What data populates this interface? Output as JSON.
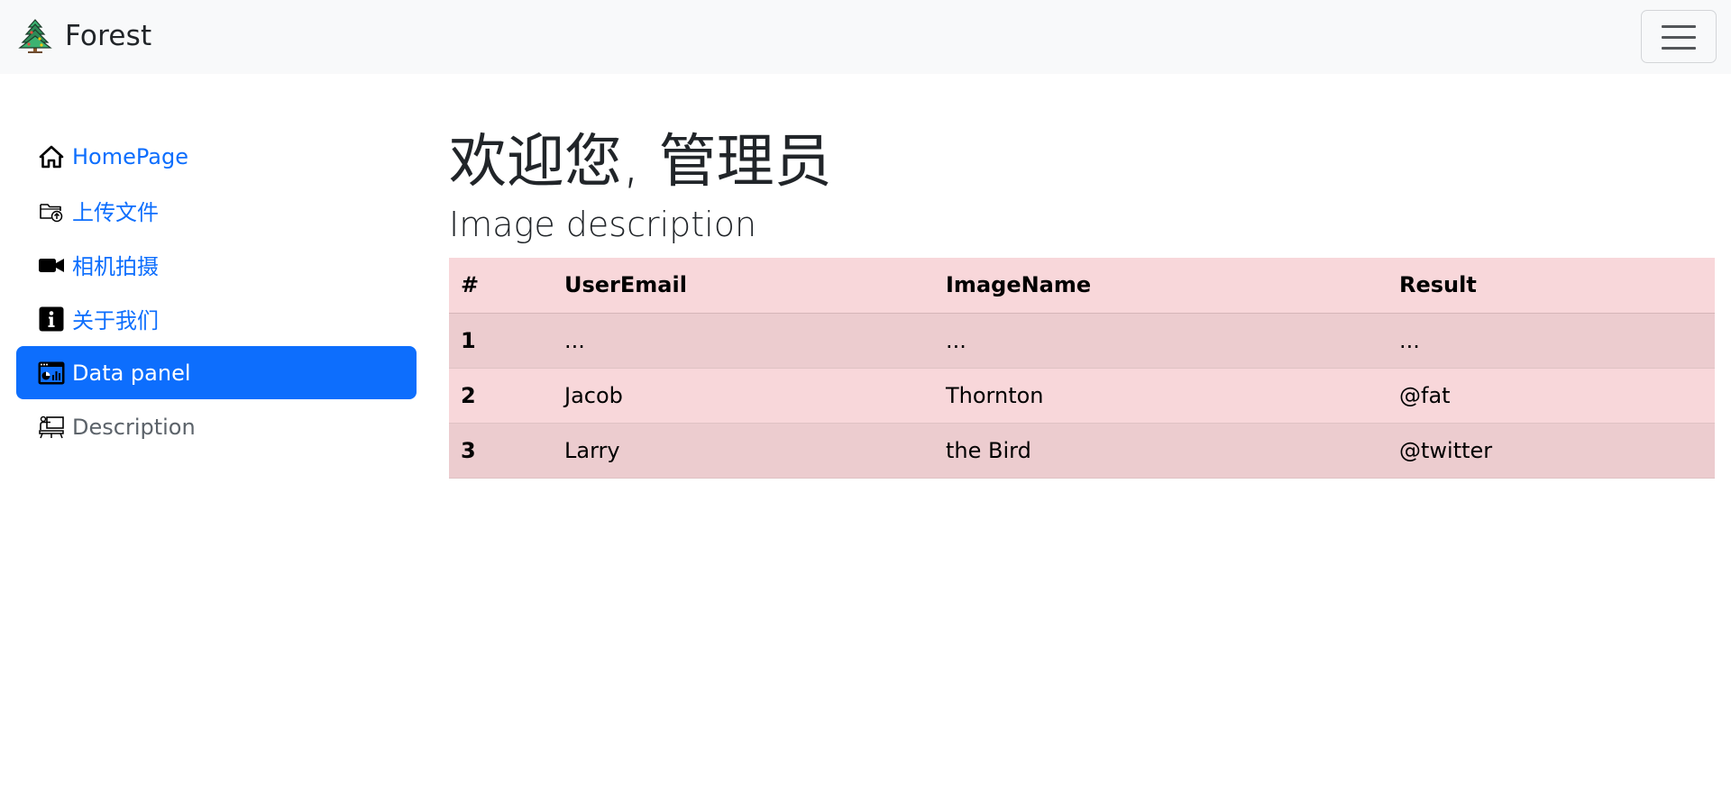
{
  "navbar": {
    "brand": "Forest",
    "brand_icon": "tree-icon",
    "toggle_icon": "hamburger-menu-icon"
  },
  "sidebar": {
    "items": [
      {
        "label": "HomePage",
        "icon": "home-icon",
        "active": false
      },
      {
        "label": "上传文件",
        "icon": "folder-upload-icon",
        "active": false
      },
      {
        "label": "相机拍摄",
        "icon": "video-camera-icon",
        "active": false
      },
      {
        "label": "关于我们",
        "icon": "info-icon",
        "active": false
      },
      {
        "label": "Data panel",
        "icon": "data-panel-icon",
        "active": true
      },
      {
        "label": "Description",
        "icon": "presentation-icon",
        "active": false
      }
    ]
  },
  "main": {
    "title": "欢迎您, 管理员",
    "subtitle": "Image description",
    "table": {
      "headers": [
        "#",
        "UserEmail",
        "ImageName",
        "Result"
      ],
      "rows": [
        [
          "1",
          "...",
          "...",
          "..."
        ],
        [
          "2",
          "Jacob",
          "Thornton",
          "@fat"
        ],
        [
          "3",
          "Larry",
          "the Bird",
          "@twitter"
        ]
      ]
    }
  },
  "colors": {
    "accent": "#0d6efd",
    "table_bg": "#f8d7da",
    "table_stripe": "#eccccf",
    "navbar_bg": "#f8f9fa"
  }
}
